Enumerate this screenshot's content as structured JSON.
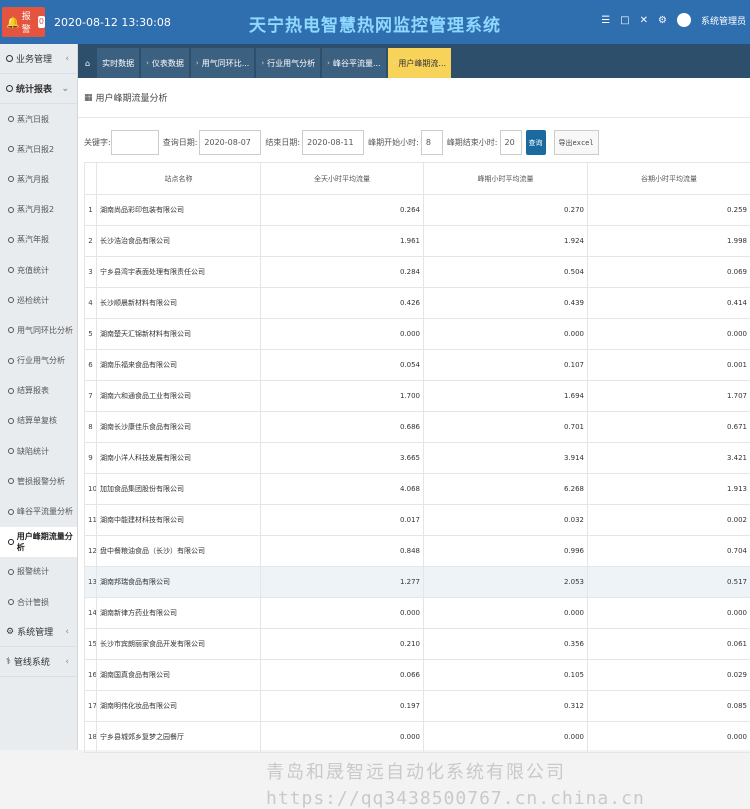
{
  "header": {
    "alarm_label": "报警",
    "alarm_count": "0",
    "datetime": "2020-08-12 13:30:08",
    "system_title": "天宁热电智慧热网监控管理系统",
    "user_name": "系统管理员"
  },
  "sidebar": {
    "business_mgmt": "业务管理",
    "stat_reports": "统计报表",
    "items": [
      "蒸汽日报",
      "蒸汽日报2",
      "蒸汽月报",
      "蒸汽月报2",
      "蒸汽年报",
      "充值统计",
      "巡检统计",
      "用气同环比分析",
      "行业用气分析",
      "结算报表",
      "结算单复核",
      "缺陷统计",
      "管损报警分析",
      "峰谷平流量分析",
      "用户峰期流量分析",
      "报警统计",
      "合计管损"
    ],
    "active_index": 14,
    "system_mgmt": "系统管理",
    "pipe_system": "管线系统"
  },
  "tabs": [
    {
      "label": "实时数据"
    },
    {
      "label": "仪表数据"
    },
    {
      "label": "用气同环比..."
    },
    {
      "label": "行业用气分析"
    },
    {
      "label": "峰谷平流量..."
    },
    {
      "label": "用户峰期流..."
    }
  ],
  "panel": {
    "title": "用户峰期流量分析"
  },
  "filters": {
    "keyword_label": "关键字:",
    "keyword_value": "",
    "start_label": "查询日期:",
    "start_value": "2020-08-07",
    "end_label": "结束日期:",
    "end_value": "2020-08-11",
    "peak_start_label": "峰期开始小时:",
    "peak_start_value": "8",
    "peak_end_label": "峰期结束小时:",
    "peak_end_value": "20",
    "search_label": "查询",
    "export_label": "导出excel"
  },
  "table": {
    "headers": [
      "站点名称",
      "全天小时平均流量",
      "峰期小时平均流量",
      "谷期小时平均流量"
    ],
    "rows": [
      {
        "idx": "1",
        "name": "湖南尚品彩印包装有限公司",
        "all": "0.264",
        "peak": "0.270",
        "valley": "0.259"
      },
      {
        "idx": "2",
        "name": "长沙浩治食品有限公司",
        "all": "1.961",
        "peak": "1.924",
        "valley": "1.998"
      },
      {
        "idx": "3",
        "name": "宁乡县湾宇表面处理有限责任公司",
        "all": "0.284",
        "peak": "0.504",
        "valley": "0.069"
      },
      {
        "idx": "4",
        "name": "长沙顺晨新材料有限公司",
        "all": "0.426",
        "peak": "0.439",
        "valley": "0.414"
      },
      {
        "idx": "5",
        "name": "湖南楚天汇锦新材料有限公司",
        "all": "0.000",
        "peak": "0.000",
        "valley": "0.000"
      },
      {
        "idx": "6",
        "name": "湖南乐福来食品有限公司",
        "all": "0.054",
        "peak": "0.107",
        "valley": "0.001"
      },
      {
        "idx": "7",
        "name": "湖南六和通食品工业有限公司",
        "all": "1.700",
        "peak": "1.694",
        "valley": "1.707"
      },
      {
        "idx": "8",
        "name": "湖南长沙康佳乐食品有限公司",
        "all": "0.686",
        "peak": "0.701",
        "valley": "0.671"
      },
      {
        "idx": "9",
        "name": "湖南小洋人科技发展有限公司",
        "all": "3.665",
        "peak": "3.914",
        "valley": "3.421"
      },
      {
        "idx": "10",
        "name": "加加食品集团股份有限公司",
        "all": "4.068",
        "peak": "6.268",
        "valley": "1.913"
      },
      {
        "idx": "11",
        "name": "湖南中能建材科技有限公司",
        "all": "0.017",
        "peak": "0.032",
        "valley": "0.002"
      },
      {
        "idx": "12",
        "name": "盘中餐粮油食品（长沙）有限公司",
        "all": "0.848",
        "peak": "0.996",
        "valley": "0.704"
      },
      {
        "idx": "13",
        "name": "湖南邦瑞食品有限公司",
        "all": "1.277",
        "peak": "2.053",
        "valley": "0.517"
      },
      {
        "idx": "14",
        "name": "湖南新律方药业有限公司",
        "all": "0.000",
        "peak": "0.000",
        "valley": "0.000"
      },
      {
        "idx": "15",
        "name": "长沙市宾朗丽家食品开发有限公司",
        "all": "0.210",
        "peak": "0.356",
        "valley": "0.061"
      },
      {
        "idx": "16",
        "name": "湖南国真食品有限公司",
        "all": "0.066",
        "peak": "0.105",
        "valley": "0.029"
      },
      {
        "idx": "17",
        "name": "湖南明伟化妆品有限公司",
        "all": "0.197",
        "peak": "0.312",
        "valley": "0.085"
      },
      {
        "idx": "18",
        "name": "宁乡县城郊乡复梦之园餐厅",
        "all": "0.000",
        "peak": "0.000",
        "valley": "0.000"
      }
    ],
    "highlight_row": 12
  },
  "watermark": {
    "line1": "青岛和晟智远自动化系统有限公司",
    "line2": "https://qq3438500767.cn.china.cn"
  }
}
